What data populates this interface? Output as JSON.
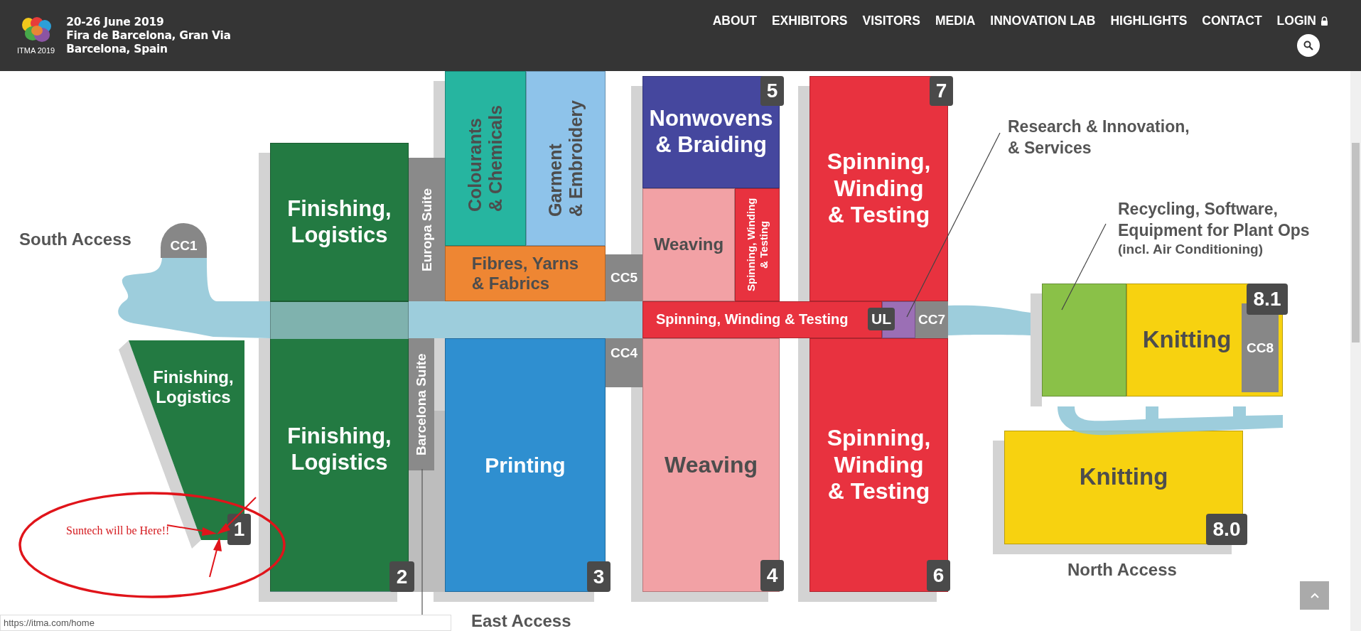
{
  "header": {
    "logo_text": "ITMA 2019",
    "event_info": [
      "20-26 June 2019",
      "Fira de Barcelona, Gran Via",
      "Barcelona, Spain"
    ],
    "nav": [
      {
        "label": "ABOUT",
        "kind": "link"
      },
      {
        "label": "EXHIBITORS",
        "kind": "link"
      },
      {
        "label": "VISITORS",
        "kind": "link"
      },
      {
        "label": "MEDIA",
        "kind": "link"
      },
      {
        "label": "INNOVATION LAB",
        "kind": "link"
      },
      {
        "label": "HIGHLIGHTS",
        "kind": "link"
      },
      {
        "label": "CONTACT",
        "kind": "link"
      },
      {
        "label": "LOGIN",
        "kind": "login"
      }
    ]
  },
  "map": {
    "areas": [
      {
        "label": "Colourants\n& Chemicals",
        "color": "#26b5a0"
      },
      {
        "label": "Garment\n& Embroidery",
        "color": "#8ec3ea"
      },
      {
        "label": "Fibres, Yarns\n& Fabrics",
        "color": "#ee8633"
      },
      {
        "label": "Printing",
        "color": "#2f8fd0"
      },
      {
        "label": "Finishing,\nLogistics",
        "color": "#237a42"
      },
      {
        "label": "Finishing,\nLogistics",
        "color": "#237a42"
      },
      {
        "label": "Finishing,\nLogistics",
        "color": "#237a42"
      },
      {
        "label": "Nonwovens\n& Braiding",
        "color": "#45479e"
      },
      {
        "label": "Weaving",
        "color": "#f2a1a5"
      },
      {
        "label": "Spinning, Winding\n& Testing",
        "color": "#e8323f"
      },
      {
        "label": "Spinning, Winding & Testing",
        "color": "#e8323f"
      },
      {
        "label": "Weaving",
        "color": "#f2a1a5"
      },
      {
        "label": "Spinning,\nWinding\n& Testing",
        "color": "#e8323f"
      },
      {
        "label": "Spinning,\nWinding\n& Testing",
        "color": "#e8323f"
      },
      {
        "color": "#8ac148"
      },
      {
        "label": "Knitting",
        "color": "#f7d210"
      },
      {
        "label": "Knitting",
        "color": "#f7d210"
      },
      {
        "color": "#9b6fb5"
      }
    ],
    "suites": [
      {
        "label": "Europa Suite"
      },
      {
        "label": "Barcelona Suite"
      }
    ],
    "service_points": [
      {
        "label": "CC1",
        "kind": "dome"
      },
      {
        "label": "CC5",
        "kind": "block"
      },
      {
        "label": "CC4",
        "kind": "block"
      },
      {
        "label": "UL",
        "kind": "badge"
      },
      {
        "label": "CC7",
        "kind": "block"
      },
      {
        "label": "CC8",
        "kind": "block"
      }
    ],
    "hall_numbers": [
      "1",
      "2",
      "3",
      "4",
      "6",
      "5",
      "7",
      "8.1",
      "8.0"
    ],
    "access_labels": [
      "South Access",
      "East Access",
      "North Access"
    ],
    "callouts": [
      {
        "text": "Research & Innovation,\n& Services"
      },
      {
        "text": "Recycling, Software,\nEquipment for Plant Ops",
        "note": "(incl. Air Conditioning)"
      }
    ],
    "annotation": {
      "text": "Suntech will be Here!!"
    }
  },
  "status_bar": {
    "url": "https://itma.com/home"
  }
}
